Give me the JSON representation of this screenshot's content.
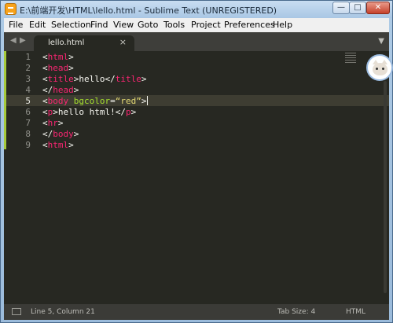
{
  "window": {
    "title": "E:\\前端开发\\HTML\\lello.html - Sublime Text (UNREGISTERED)",
    "buttons": {
      "minimize": "—",
      "maximize": "□",
      "close": "✕"
    }
  },
  "menu": [
    "File",
    "Edit",
    "Selection",
    "Find",
    "View",
    "Goto",
    "Tools",
    "Project",
    "Preferences",
    "Help"
  ],
  "tab": {
    "label": "lello.html",
    "close": "×"
  },
  "editor": {
    "line_numbers": [
      "1",
      "2",
      "3",
      "4",
      "5",
      "6",
      "7",
      "8",
      "9"
    ],
    "current_line": 5,
    "code_lines": [
      [
        [
          "<",
          "p"
        ],
        [
          "html",
          "t"
        ],
        [
          ">",
          "p"
        ]
      ],
      [
        [
          "<",
          "p"
        ],
        [
          "head",
          "t"
        ],
        [
          ">",
          "p"
        ]
      ],
      [
        [
          "<",
          "p"
        ],
        [
          "title",
          "t"
        ],
        [
          ">hello</",
          "p"
        ],
        [
          "title",
          "t"
        ],
        [
          ">",
          "p"
        ]
      ],
      [
        [
          "</",
          "p"
        ],
        [
          "head",
          "t"
        ],
        [
          ">",
          "p"
        ]
      ],
      [
        [
          "<",
          "p"
        ],
        [
          "body",
          "t"
        ],
        [
          " ",
          "p"
        ],
        [
          "bgcolor",
          "a"
        ],
        [
          "=",
          "p"
        ],
        [
          "“red”",
          "s"
        ],
        [
          ">",
          "p"
        ]
      ],
      [
        [
          "<",
          "p"
        ],
        [
          "p",
          "t"
        ],
        [
          ">hello html!</",
          "p"
        ],
        [
          "p",
          "t"
        ],
        [
          ">",
          "p"
        ]
      ],
      [
        [
          "<",
          "p"
        ],
        [
          "hr",
          "t"
        ],
        [
          ">",
          "p"
        ]
      ],
      [
        [
          "</",
          "p"
        ],
        [
          "body",
          "t"
        ],
        [
          ">",
          "p"
        ]
      ],
      [
        [
          "<",
          "p"
        ],
        [
          "html",
          "t"
        ],
        [
          ">",
          "p"
        ]
      ]
    ]
  },
  "status": {
    "position": "Line 5, Column 21",
    "tab_size": "Tab Size: 4",
    "syntax": "HTML"
  },
  "icons": [
    "sublime-app-icon",
    "left-arrow-icon",
    "right-arrow-icon",
    "dropdown-arrow-icon",
    "panel-toggle-icon",
    "cat-avatar-icon"
  ],
  "colors": {
    "editor_bg": "#272822",
    "tag": "#f92672",
    "attribute": "#a6e22e",
    "string": "#e6db74",
    "text": "#f8f8f2"
  }
}
